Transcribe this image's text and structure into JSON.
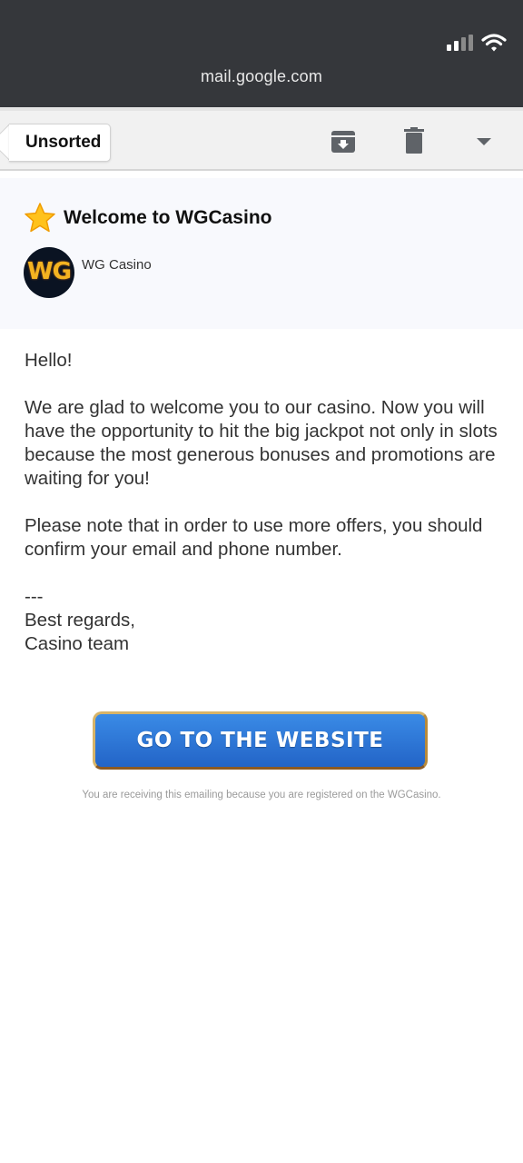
{
  "browser": {
    "url": "mail.google.com"
  },
  "toolbar": {
    "back_label": "Unsorted"
  },
  "email": {
    "subject": "Welcome to WGCasino",
    "sender_name": "WG Casino",
    "avatar_text": "WG",
    "greeting": "Hello!",
    "paragraph1": "We are glad to welcome you to our casino. Now you will have the opportunity to hit the big jackpot not only in slots because the most generous bonuses and promotions are waiting for you!",
    "paragraph2": "Please note that in order to use more offers, you should confirm your email and phone number.",
    "separator": "---",
    "signoff": "Best regards,",
    "signature": "Casino team",
    "cta_label": "GO TO THE WEBSITE",
    "footer_note": "You are receiving this emailing because you are registered on the WGCasino."
  },
  "colors": {
    "status_bar": "#35373b",
    "cta_blue": "#2f78d9",
    "cta_border_gold": "#d7b468",
    "avatar_bg": "#0a1322",
    "avatar_gold": "#f3b321"
  },
  "icons": [
    "signal-icon",
    "wifi-icon",
    "archive-icon",
    "trash-icon",
    "dropdown-icon",
    "star-icon"
  ]
}
